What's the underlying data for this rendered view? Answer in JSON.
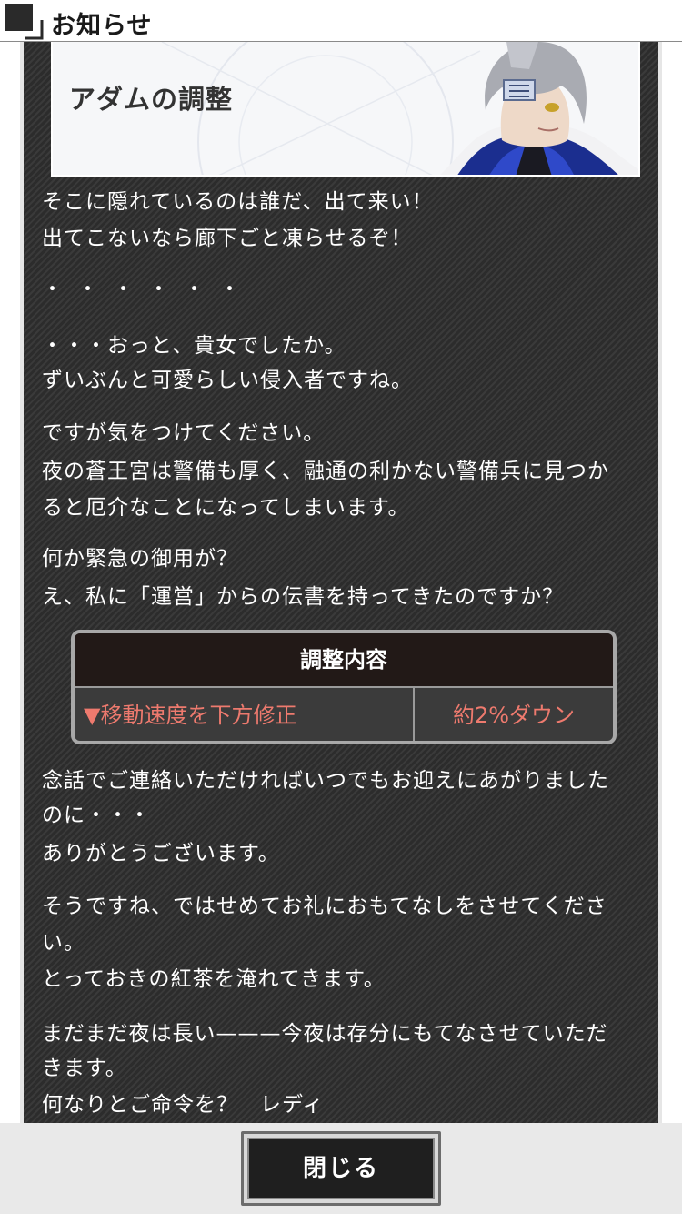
{
  "header": {
    "title": "お知らせ",
    "icon": "notice-icon"
  },
  "banner": {
    "title": "アダムの調整"
  },
  "body": {
    "p1": [
      "そこに隠れているのは誰だ、出て来い！",
      "出てこないなら廊下ごと凍らせるぞ！"
    ],
    "p2": [
      "・・・・・・"
    ],
    "p3": [
      "・・・おっと、貴女でしたか。",
      "ずいぶんと可愛らしい侵入者ですね。"
    ],
    "p4": [
      "ですが気をつけてください。",
      "夜の蒼王宮は警備も厚く、融通の利かない警備兵に見つか",
      "ると厄介なことになってしまいます。"
    ],
    "p5": [
      "何か緊急の御用が？",
      "え、私に「運営」からの伝書を持ってきたのですか？"
    ],
    "p6": [
      "念話でご連絡いただければいつでもお迎えにあがりました",
      "のに・・・",
      "ありがとうございます。"
    ],
    "p7": [
      "そうですね、ではせめてお礼におもてなしをさせてくださ",
      "い。",
      "とっておきの紅茶を淹れてきます。"
    ],
    "p8": [
      "まだまだ夜は長い———今夜は存分にもてなさせていただ",
      "きます。",
      "何なりとご命令を？　レディ"
    ]
  },
  "adjustment": {
    "header": "調整内容",
    "item": "▼移動速度を下方修正",
    "value": "約2%ダウン",
    "colors": {
      "header_bg": "#221917",
      "text": "#ee7a6e"
    }
  },
  "footer": {
    "close_label": "閉じる"
  }
}
